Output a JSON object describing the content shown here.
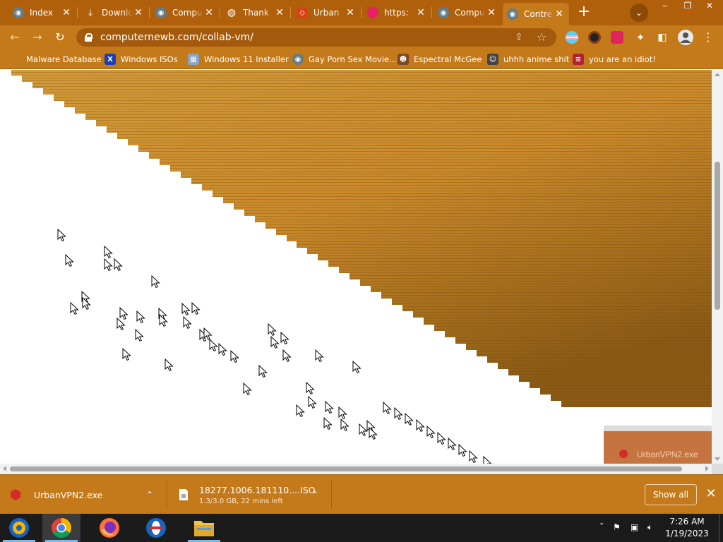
{
  "window": {
    "tabs": [
      {
        "label": "Index",
        "favicon": "vm-icon",
        "color": "#607d8b"
      },
      {
        "label": "Downloads",
        "favicon": "download-icon",
        "color": "#ffffff"
      },
      {
        "label": "Computernewb",
        "favicon": "vm-icon",
        "color": "#607d8b"
      },
      {
        "label": "Thank",
        "favicon": "globe-icon",
        "color": "#ffffff"
      },
      {
        "label": "Urban",
        "favicon": "urban-vpn-icon",
        "color": "#d84315"
      },
      {
        "label": "https:",
        "favicon": "pink-circle-icon",
        "color": "#e91e63"
      },
      {
        "label": "Computernewb",
        "favicon": "vm-icon",
        "color": "#607d8b"
      },
      {
        "label": "Contrevenant",
        "favicon": "vm-icon",
        "color": "#607d8b"
      }
    ],
    "active_tab_index": 7,
    "controls": {
      "new_tab": "+",
      "tab_search": "⌄",
      "minimize": "‒",
      "maximize": "❐",
      "close": "✕"
    }
  },
  "toolbar": {
    "back": "←",
    "forward": "→",
    "reload": "↻",
    "url": "computernewb.com/collab-vm/",
    "share_icon": "⇪",
    "bookmark_star": "☆",
    "extensions": [
      "trans-flag-ext-icon",
      "avatar-ext-icon",
      "red-puzzle-ext-icon"
    ],
    "puzzle_icon": "puzzle-icon",
    "sidepanel_icon": "side-panel-icon",
    "profile_icon": "profile-icon",
    "menu_icon": "⋮"
  },
  "bookmarks": [
    {
      "label": "Malware Database",
      "icon": "malware-db-icon",
      "color": "#333333",
      "glyph": ""
    },
    {
      "label": "Windows ISOs",
      "icon": "x-icon",
      "color": "#1a3db8",
      "glyph": "X"
    },
    {
      "label": "Windows 11 Installer",
      "icon": "image-icon",
      "color": "#8aa4c8",
      "glyph": "▦"
    },
    {
      "label": "Gay Porn Sex Movie...",
      "icon": "vm-icon",
      "color": "#607d8b",
      "glyph": "◉"
    },
    {
      "label": "Espectral McGee",
      "icon": "character-icon",
      "color": "#7a4b2a",
      "glyph": "☻"
    },
    {
      "label": "uhhh anime shit",
      "icon": "anime-icon",
      "color": "#444444",
      "glyph": "☺"
    },
    {
      "label": "you are an idiot!",
      "icon": "flag-icon",
      "color": "#b22234",
      "glyph": "≡"
    }
  ],
  "downloads": {
    "items": [
      {
        "name": "UrbanVPN2.exe",
        "status": "",
        "icon": "urban-vpn-icon"
      },
      {
        "name": "18277.1006.181110....ISO",
        "status": "1.3/3.0 GB, 22 mins left",
        "icon": "file-icon"
      }
    ],
    "show_all": "Show all",
    "close": "✕",
    "chevron": "⌃"
  },
  "vm_screen": {
    "overlay_label": "UrbanVPN2.exe",
    "colors": {
      "gold_light": "#d19a3a",
      "gold_dark": "#8a5a14"
    }
  },
  "taskbar": {
    "apps": [
      "collabvm-app-icon",
      "chrome-icon",
      "firefox-icon",
      "opera-icon",
      "file-explorer-icon"
    ],
    "tray_chevron": "⌃",
    "time": "7:26 AM",
    "date": "1/19/2023"
  }
}
